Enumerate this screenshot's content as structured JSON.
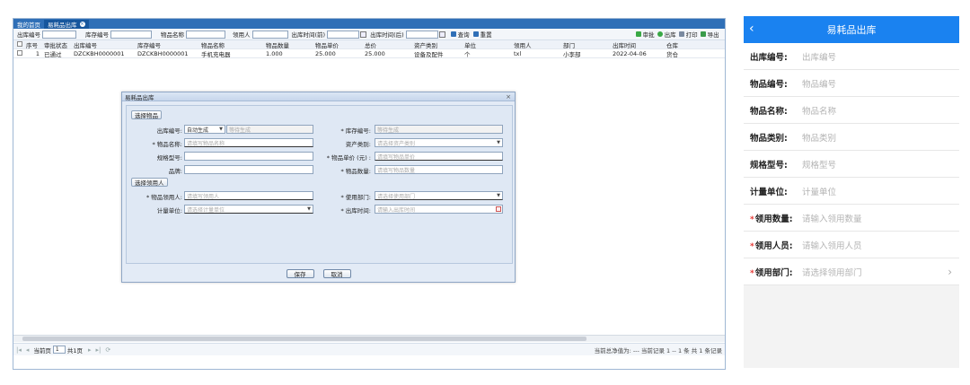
{
  "tabs": [
    "我的首页",
    "易耗品出库"
  ],
  "search": {
    "fields": [
      "出库编号",
      "库存编号",
      "物品名称",
      "领用人",
      "出库时间(前)",
      "出库时间(后)"
    ],
    "query_label": "查询",
    "reset_label": "重置",
    "toolbar": [
      "审批",
      "出库",
      "打印",
      "导出"
    ]
  },
  "grid": {
    "columns": [
      "序号",
      "审批状态",
      "出库编号",
      "库存编号",
      "物品名称",
      "物品数量",
      "物品单价",
      "总价",
      "资产类别",
      "单位",
      "领用人",
      "部门",
      "出库时间",
      "仓库"
    ],
    "rows": [
      [
        "1",
        "已通过",
        "DZCKBH0000001",
        "DZCKBH0000001",
        "手机充电器",
        "1.000",
        "25.000",
        "25.000",
        "设备及配件",
        "个",
        "txl",
        "小李部",
        "2022-04-06",
        "货仓"
      ]
    ]
  },
  "pager": {
    "page_label": "当前页",
    "page_value": "1",
    "total_pages": "共1页",
    "summary": "当前总净值为: --- 当前记录 1 -- 1 条 共 1 条记录"
  },
  "dialog": {
    "title": "易耗品出库",
    "select_item_button": "选择物品",
    "select_user_button": "选择领用人",
    "fields": {
      "out_no": {
        "label": "出库编号:",
        "value": "自动生成",
        "placeholder": "等待生成"
      },
      "stock_no": {
        "label": "* 库存编号:",
        "placeholder": "等待生成"
      },
      "item_name": {
        "label": "* 物品名称:",
        "placeholder": "请填写物品名称"
      },
      "asset_type": {
        "label": "资产类别:",
        "placeholder": "请选择资产类别"
      },
      "spec": {
        "label": "规格型号:",
        "placeholder": ""
      },
      "unit_price": {
        "label": "* 物品单价 (元) :",
        "placeholder": "请填写物品单价"
      },
      "brand": {
        "label": "品牌:",
        "placeholder": ""
      },
      "quantity": {
        "label": "* 物品数量:",
        "placeholder": "请填写物品数量"
      },
      "receiver": {
        "label": "* 物品领用人:",
        "placeholder": "请填写领用人"
      },
      "dept": {
        "label": "* 使用部门:",
        "placeholder": "请选择使用部门"
      },
      "unit": {
        "label": "计量单位:",
        "placeholder": "请选择计量单位"
      },
      "out_time": {
        "label": "* 出库时间:",
        "placeholder": "请输入出库时间"
      }
    },
    "save_button": "保存",
    "cancel_button": "取消"
  },
  "mobile": {
    "title": "易耗品出库",
    "rows": [
      {
        "label": "出库编号:",
        "placeholder": "出库编号",
        "required": false
      },
      {
        "label": "物品编号:",
        "placeholder": "物品编号",
        "required": false
      },
      {
        "label": "物品名称:",
        "placeholder": "物品名称",
        "required": false
      },
      {
        "label": "物品类别:",
        "placeholder": "物品类别",
        "required": false
      },
      {
        "label": "规格型号:",
        "placeholder": "规格型号",
        "required": false
      },
      {
        "label": "计量单位:",
        "placeholder": "计量单位",
        "required": false
      },
      {
        "label": "领用数量:",
        "placeholder": "请输入领用数量",
        "required": true
      },
      {
        "label": "领用人员:",
        "placeholder": "请输入领用人员",
        "required": true
      },
      {
        "label": "领用部门:",
        "placeholder": "请选择领用部门",
        "required": true
      }
    ]
  },
  "colors": {
    "header_blue": "#2f6fb7",
    "mobile_blue": "#1a82f0",
    "required_red": "#e53935"
  }
}
